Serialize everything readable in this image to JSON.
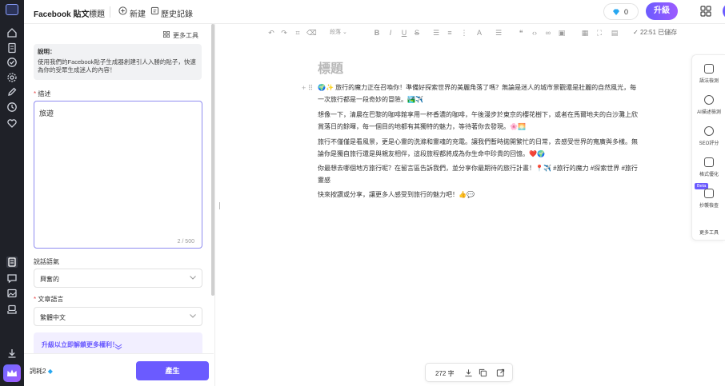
{
  "app": {
    "title": "Facebook 貼文",
    "tabs": [
      "標題",
      "新建",
      "歷史記錄"
    ],
    "credits": "0",
    "upgrade_label": "升級"
  },
  "sidebar": {
    "icons": [
      "home-icon",
      "document-icon",
      "check-circle-icon",
      "gear-icon",
      "edit-icon",
      "history-icon",
      "heart-icon",
      "article-icon",
      "chat-icon",
      "image-icon",
      "stack-icon",
      "download-icon",
      "crown-icon"
    ]
  },
  "form": {
    "more_tools": "更多工具",
    "info_title": "說明：",
    "info_text": "使用我們的Facebook貼子生成器創建引人入勝的貼子，快速為你的受眾生成迷人的內容！",
    "desc_label": "描述",
    "desc_value": "旅遊",
    "desc_count": "2 / 500",
    "tone_label": "說話語氣",
    "tone_value": "興奮的",
    "lang_label": "文章語言",
    "lang_value": "繁體中文",
    "promo_text": "升級以立即解鎖更多權利！",
    "balance": "詞耗2",
    "generate_label": "產生"
  },
  "toolbar": {
    "paragraph": "段落",
    "saved": "22:51 已儲存"
  },
  "document": {
    "title": "標題",
    "paragraphs": [
      "🌍✨ 旅行的魔力正在召喚你！準備好探索世界的美麗角落了嗎？無論是迷人的城市景觀還是壯麗的自然風光，每一次旅行都是一段奇妙的冒險。🏞️✈️",
      "想像一下，清晨在巴黎的咖啡館享用一杯香濃的咖啡，午後漫步於東京的櫻花樹下，或者在馬爾地夫的白沙灘上欣賞落日的餘暉，每一個目的地都有其獨特的魅力，等待著你去發現。🌸🌅",
      "旅行不僅僅是看風景，更是心靈的洗滌和靈魂的充電。讓我們暫時拋開繁忙的日常，去感受世界的寬廣與多樣。無論你是獨自旅行還是與親友相伴，這段旅程都將成為你生命中珍貴的回憶。❤️🌍",
      "你最想去哪個地方旅行呢？在留言區告訴我們，並分享你最期待的旅行計畫！📍✈️ #旅行的魔力 #探索世界 #旅行靈感",
      "快來按讚或分享，讓更多人感受到旅行的魅力吧！👍💬"
    ]
  },
  "right_panel": {
    "items": [
      "語法檢測",
      "AI描述檢測",
      "SEO評分",
      "格式優化",
      "抄襲檢查",
      "更多工具"
    ],
    "beta": "Beta"
  },
  "footer": {
    "word_count": "272 字"
  }
}
